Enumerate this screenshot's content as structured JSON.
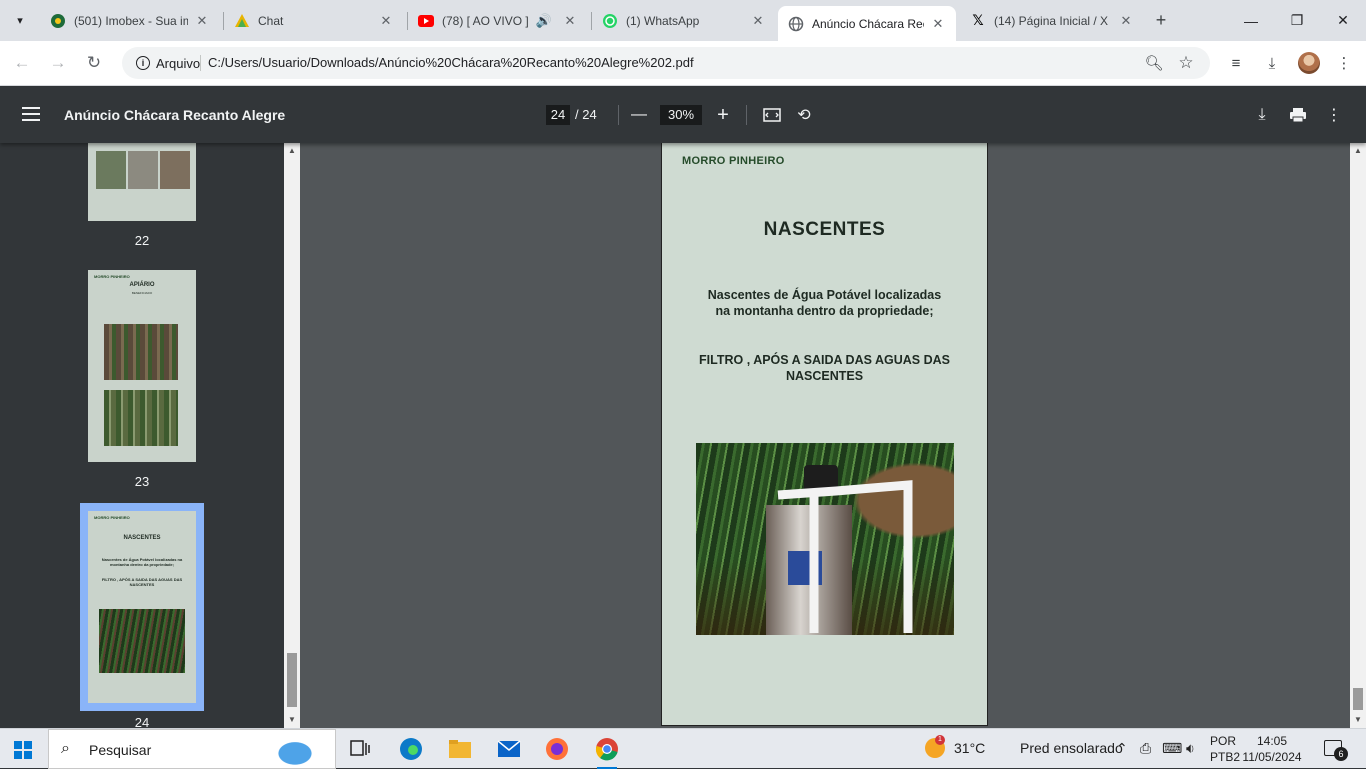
{
  "browser": {
    "tabs": [
      {
        "title": "(501) Imobex - Sua im",
        "icon": "imobex-icon"
      },
      {
        "title": "Chat",
        "icon": "chat-icon"
      },
      {
        "title": "(78) [ AO VIVO ] L",
        "icon": "youtube-icon"
      },
      {
        "title": "(1) WhatsApp",
        "icon": "whatsapp-icon"
      },
      {
        "title": "Anúncio Chácara Rec",
        "icon": "globe-icon"
      },
      {
        "title": "(14) Página Inicial / X",
        "icon": "x-icon"
      }
    ],
    "active_tab": 4,
    "chip_label": "Arquivo",
    "url": "C:/Users/Usuario/Downloads/Anúncio%20Chácara%20Recanto%20Alegre%202.pdf"
  },
  "pdf": {
    "title": "Anúncio Chácara Recanto Alegre",
    "current_page": "24",
    "total_pages": "/ 24",
    "zoom": "30%"
  },
  "sidebar": {
    "thumbnails": [
      {
        "number": "22"
      },
      {
        "number": "23",
        "brand": "MORRO PINHEIRO",
        "heading": "APIÁRIO",
        "sub": "BENEFICIADO"
      },
      {
        "number": "24",
        "brand": "MORRO PINHEIRO",
        "heading": "NASCENTES",
        "para1": "Nascentes de Água Potável localizadas na montanha dentro da propriedade;",
        "para2": "FILTRO , APÓS A SAIDA DAS AGUAS DAS NASCENTES"
      }
    ]
  },
  "page": {
    "brand": "MORRO PINHEIRO",
    "heading": "NASCENTES",
    "para1": "Nascentes de Água Potável localizadas na montanha dentro da propriedade;",
    "para2": "FILTRO , APÓS A SAIDA DAS AGUAS DAS NASCENTES"
  },
  "taskbar": {
    "search_label": "Pesquisar",
    "weather_temp": "31°C",
    "weather_desc": "Pred ensolarado",
    "weather_badge": "1",
    "lang_line1": "POR",
    "lang_line2": "PTB2",
    "time": "14:05",
    "date": "11/05/2024",
    "notification_count": "6"
  }
}
